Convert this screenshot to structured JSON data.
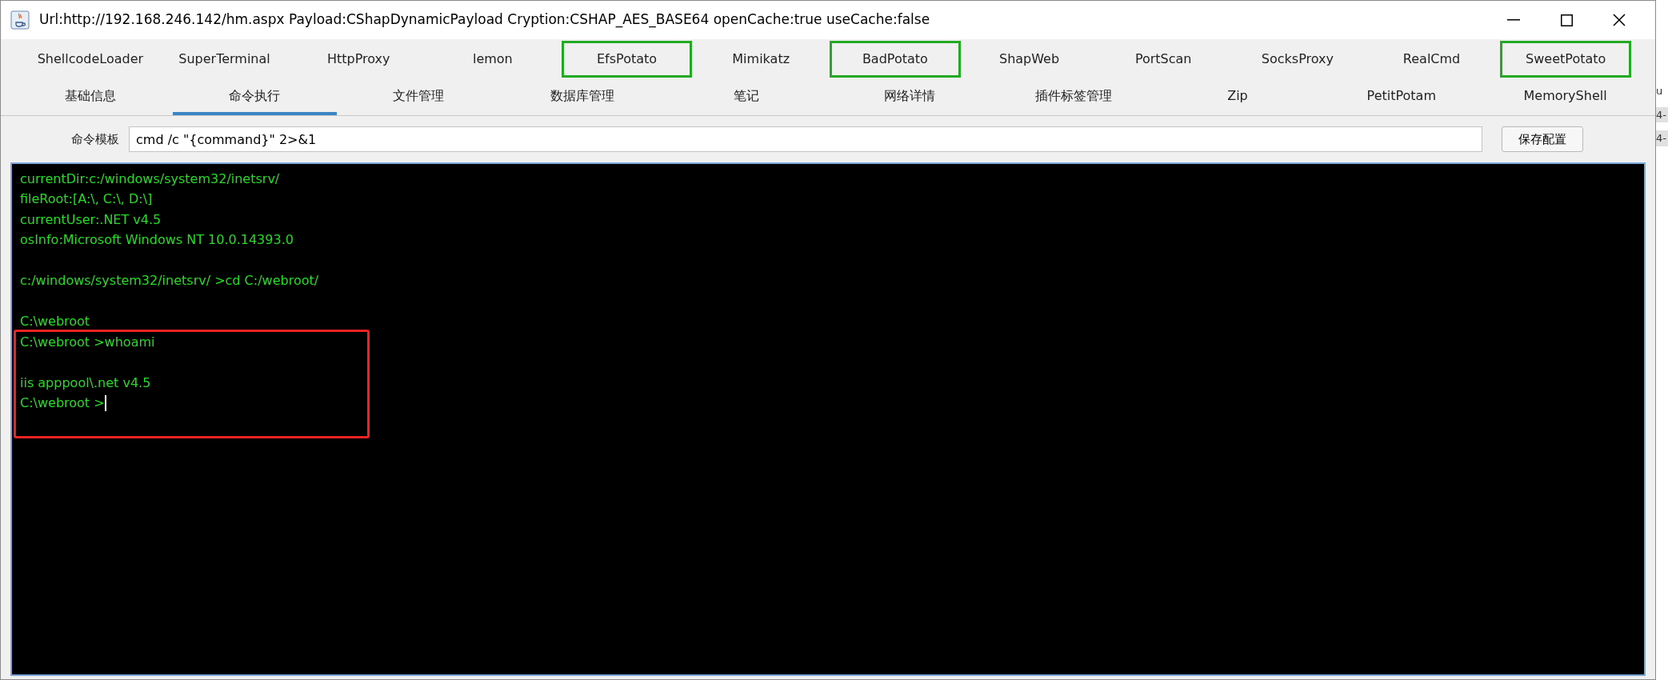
{
  "window": {
    "title": "Url:http://192.168.246.142/hm.aspx Payload:CShapDynamicPayload Cryption:CSHAP_AES_BASE64 openCache:true useCache:false"
  },
  "plugin_tabs": [
    {
      "label": "ShellcodeLoader",
      "selected": false,
      "highlighted": false
    },
    {
      "label": "SuperTerminal",
      "selected": false,
      "highlighted": false
    },
    {
      "label": "HttpProxy",
      "selected": false,
      "highlighted": false
    },
    {
      "label": "lemon",
      "selected": false,
      "highlighted": false
    },
    {
      "label": "EfsPotato",
      "selected": false,
      "highlighted": true
    },
    {
      "label": "Mimikatz",
      "selected": false,
      "highlighted": false
    },
    {
      "label": "BadPotato",
      "selected": false,
      "highlighted": true
    },
    {
      "label": "ShapWeb",
      "selected": false,
      "highlighted": false
    },
    {
      "label": "PortScan",
      "selected": false,
      "highlighted": false
    },
    {
      "label": "SocksProxy",
      "selected": false,
      "highlighted": false
    },
    {
      "label": "RealCmd",
      "selected": false,
      "highlighted": false
    },
    {
      "label": "SweetPotato",
      "selected": false,
      "highlighted": true
    }
  ],
  "main_tabs": [
    {
      "label": "基础信息",
      "selected": false
    },
    {
      "label": "命令执行",
      "selected": true
    },
    {
      "label": "文件管理",
      "selected": false
    },
    {
      "label": "数据库管理",
      "selected": false
    },
    {
      "label": "笔记",
      "selected": false
    },
    {
      "label": "网络详情",
      "selected": false
    },
    {
      "label": "插件标签管理",
      "selected": false
    },
    {
      "label": "Zip",
      "selected": false
    },
    {
      "label": "PetitPotam",
      "selected": false
    },
    {
      "label": "MemoryShell",
      "selected": false
    }
  ],
  "command_template": {
    "label": "命令模板",
    "value": "cmd /c \"{command}\" 2>&1",
    "button": "保存配置"
  },
  "terminal": {
    "blocks": [
      {
        "boxed": false,
        "lines": [
          {
            "kind": "text",
            "text": "currentDir:c:/windows/system32/inetsrv/",
            "cursor": false
          },
          {
            "kind": "text",
            "text": "fileRoot:[A:\\, C:\\, D:\\]",
            "cursor": false
          },
          {
            "kind": "text",
            "text": "currentUser:.NET v4.5",
            "cursor": false
          },
          {
            "kind": "text",
            "text": "osInfo:Microsoft Windows NT 10.0.14393.0",
            "cursor": false
          },
          {
            "kind": "blank"
          },
          {
            "kind": "text",
            "text": "c:/windows/system32/inetsrv/ >cd C:/webroot/",
            "cursor": false
          },
          {
            "kind": "blank"
          },
          {
            "kind": "text",
            "text": "C:\\webroot",
            "cursor": false
          }
        ]
      },
      {
        "boxed": true,
        "lines": [
          {
            "kind": "text",
            "text": "C:\\webroot >whoami",
            "cursor": false
          },
          {
            "kind": "blank"
          },
          {
            "kind": "text",
            "text": "iis apppool\\.net v4.5",
            "cursor": false
          },
          {
            "kind": "text",
            "text": "C:\\webroot >",
            "cursor": true
          }
        ]
      }
    ]
  },
  "background_window": {
    "fragments": [
      "u",
      "4-",
      "4-"
    ]
  }
}
